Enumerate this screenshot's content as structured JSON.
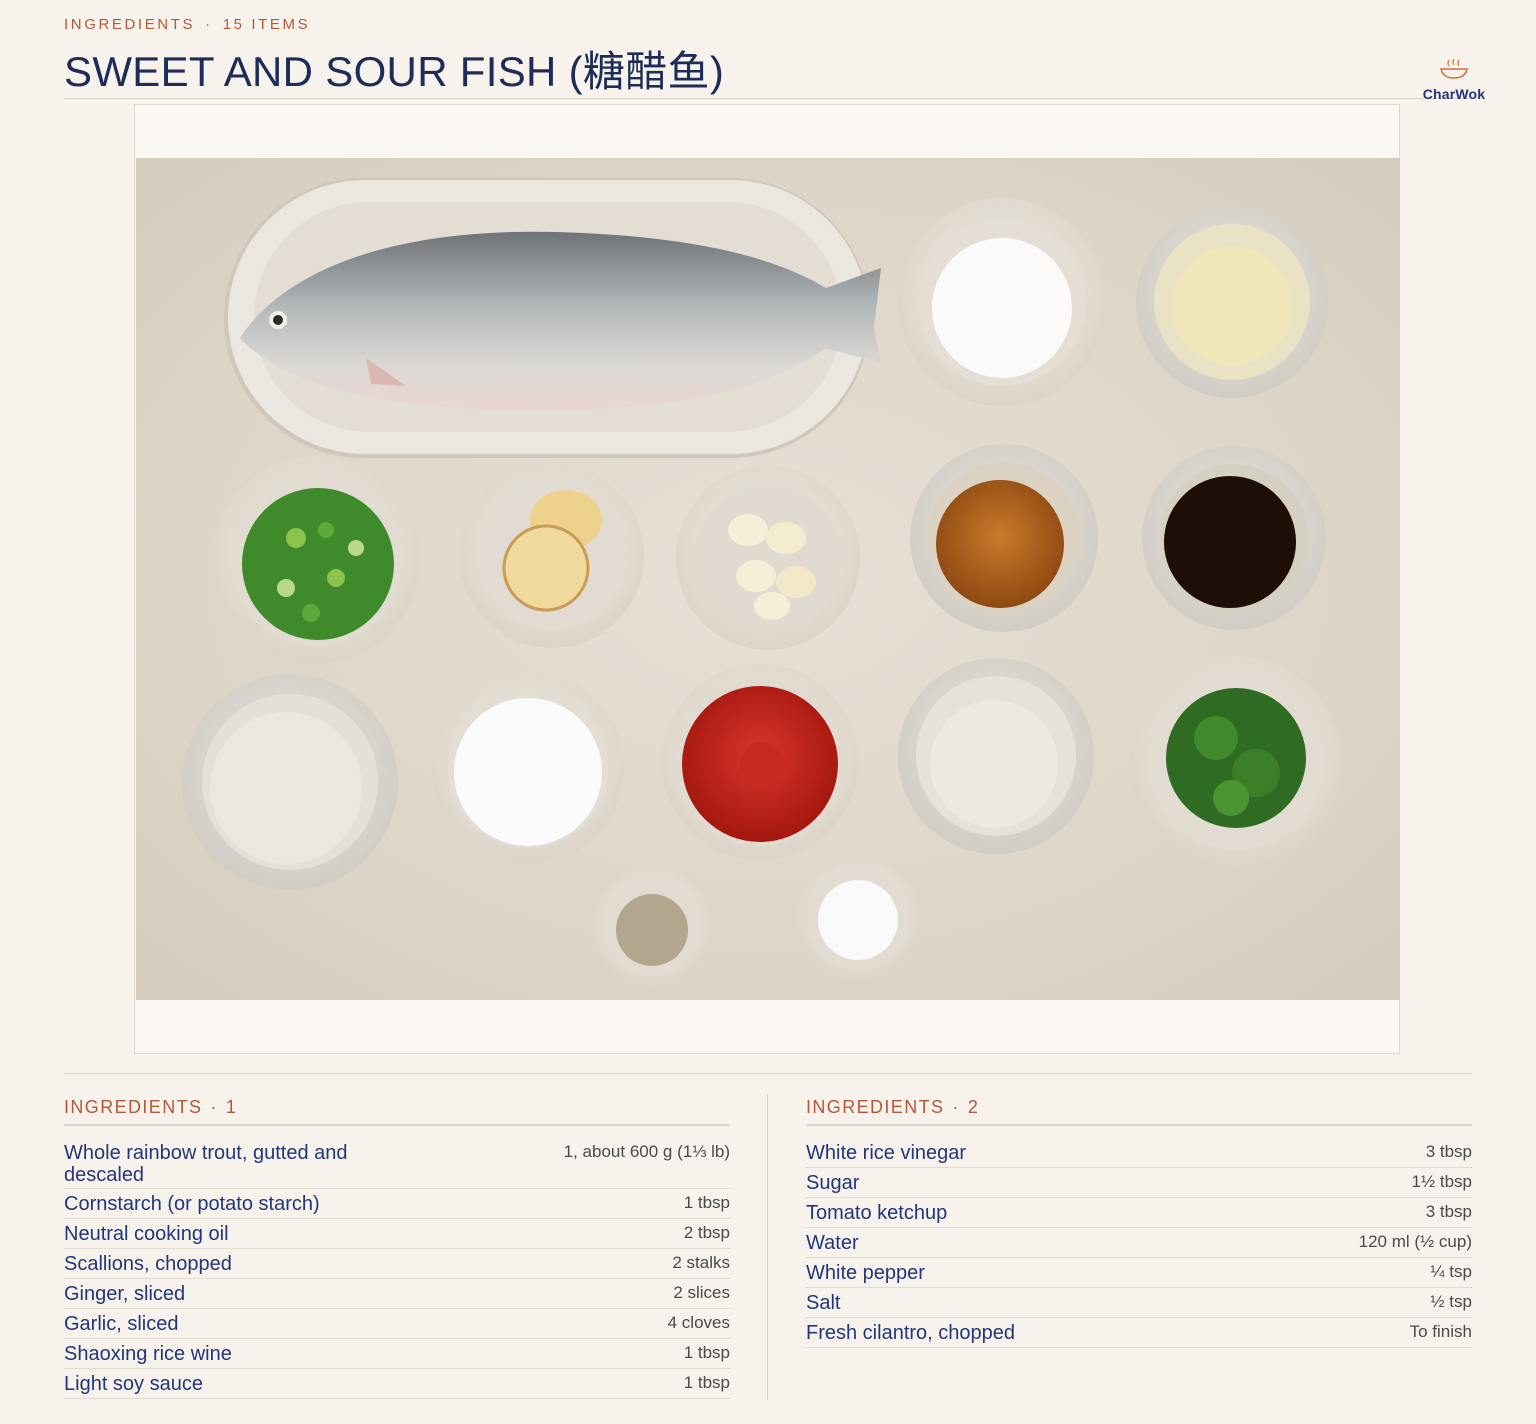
{
  "header": {
    "kicker_label": "INGREDIENTS",
    "kicker_count": "15 ITEMS",
    "kicker_sep": "·",
    "title": "SWEET AND SOUR FISH (糖醋鱼)"
  },
  "logo": {
    "brand": "CharWok",
    "icon": "steaming-bowl-icon"
  },
  "photo": {
    "items": [
      "whole trout on platter",
      "cornstarch",
      "neutral oil",
      "scallions",
      "ginger",
      "garlic",
      "shaoxing wine",
      "soy sauce",
      "white rice vinegar",
      "sugar",
      "tomato ketchup",
      "water",
      "cilantro",
      "white pepper",
      "salt"
    ]
  },
  "ingredients": [
    {
      "heading": "INGREDIENTS",
      "number": "1",
      "items": [
        {
          "name": "Whole rainbow trout, gutted and descaled",
          "amount": "1, about 600 g (1⅓ lb)"
        },
        {
          "name": "Cornstarch (or potato starch)",
          "amount": "1 tbsp"
        },
        {
          "name": "Neutral cooking oil",
          "amount": "2 tbsp"
        },
        {
          "name": "Scallions, chopped",
          "amount": "2 stalks"
        },
        {
          "name": "Ginger, sliced",
          "amount": "2 slices"
        },
        {
          "name": "Garlic, sliced",
          "amount": "4 cloves"
        },
        {
          "name": "Shaoxing rice wine",
          "amount": "1 tbsp"
        },
        {
          "name": "Light soy sauce",
          "amount": "1 tbsp"
        }
      ]
    },
    {
      "heading": "INGREDIENTS",
      "number": "2",
      "items": [
        {
          "name": "White rice vinegar",
          "amount": "3 tbsp"
        },
        {
          "name": "Sugar",
          "amount": "1½ tbsp"
        },
        {
          "name": "Tomato ketchup",
          "amount": "3 tbsp"
        },
        {
          "name": "Water",
          "amount": "120 ml (½ cup)"
        },
        {
          "name": "White pepper",
          "amount": "¼ tsp"
        },
        {
          "name": "Salt",
          "amount": "½ tsp"
        },
        {
          "name": "Fresh cilantro, chopped",
          "amount": "To finish"
        }
      ]
    }
  ],
  "colors": {
    "accent": "#b4583a",
    "ink": "#22367a",
    "background": "#f7f3ec"
  }
}
